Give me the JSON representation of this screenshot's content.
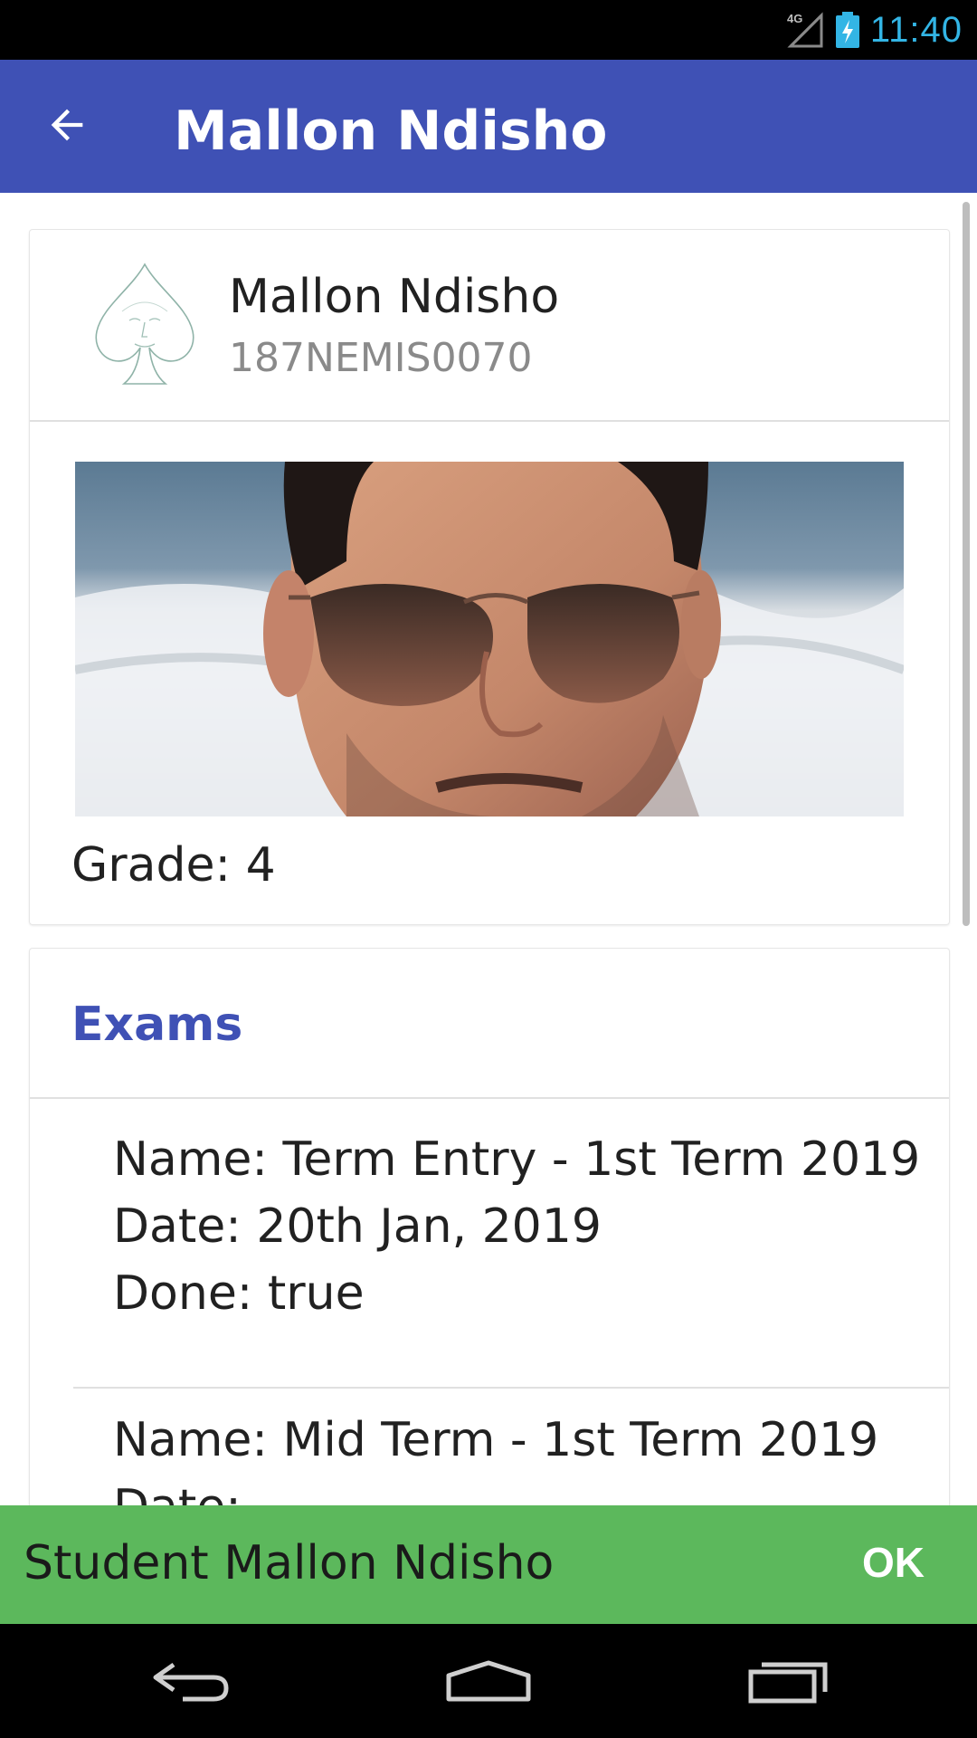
{
  "status_bar": {
    "time": "11:40",
    "network": "4G",
    "icons": [
      "signal-icon",
      "battery-icon"
    ],
    "time_color": "#33B5E5"
  },
  "app_bar": {
    "title": "Mallon Ndisho",
    "back_icon": "arrow-back-icon",
    "color": "#3F51B5"
  },
  "student": {
    "name": "Mallon Ndisho",
    "id": "187NEMIS0070",
    "grade": "Grade: 4",
    "avatar_icon": "spade-face-icon",
    "photo": "student-photo"
  },
  "exams": {
    "title": "Exams",
    "items": [
      {
        "name": "Name: Term Entry - 1st Term 2019",
        "date": "Date: 20th Jan, 2019",
        "done": "Done: true"
      },
      {
        "name": "Name: Mid Term - 1st Term 2019",
        "date": "Date:"
      }
    ]
  },
  "snackbar": {
    "message": "Student Mallon Ndisho",
    "action": "OK",
    "color": "#5CB85C"
  },
  "nav_bar": {
    "icons": [
      "nav-back-icon",
      "nav-home-icon",
      "nav-recents-icon"
    ]
  }
}
